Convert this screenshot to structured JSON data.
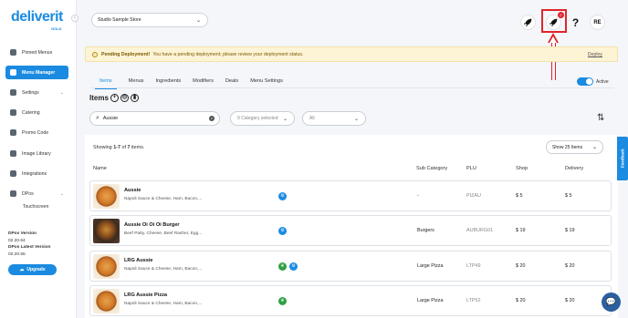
{
  "app": {
    "logo": "deliverit",
    "logo_sub": "GOLD"
  },
  "sidebar": {
    "items": [
      {
        "label": "Pinned Menus",
        "icon": "pin-icon"
      },
      {
        "label": "Menu Manager",
        "icon": "menu-manager-icon",
        "active": true
      },
      {
        "label": "Settings",
        "icon": "settings-icon",
        "expandable": true
      },
      {
        "label": "Catering",
        "icon": "catering-icon"
      },
      {
        "label": "Promo Code",
        "icon": "promo-icon"
      },
      {
        "label": "Image Library",
        "icon": "image-icon"
      },
      {
        "label": "Integrations",
        "icon": "integrations-icon"
      },
      {
        "label": "DPos",
        "icon": "dpos-icon",
        "expandable": true
      }
    ],
    "sub_item": "Touchscreen",
    "version_label": "DPos Version",
    "version_value": "02.20.64",
    "latest_label": "DPos Latest Version",
    "latest_value": "02.20.65",
    "upgrade_label": "Upgrade"
  },
  "topbar": {
    "store": "Studio Sample Store",
    "notification_count": "2",
    "help": "?",
    "avatar": "RE"
  },
  "banner": {
    "title": "Pending Deployment!",
    "message": "You have a pending deployment; please review your deployment status.",
    "action": "Deploy"
  },
  "tabs": [
    "Items",
    "Menus",
    "Ingredients",
    "Modifiers",
    "Deals",
    "Menu Settings"
  ],
  "active_toggle_label": "Active",
  "section_title": "Items",
  "search": {
    "value": "Aussie"
  },
  "filters": {
    "category": "0 Category selected",
    "status": "All"
  },
  "showing": {
    "prefix": "Showing ",
    "range": "1-7",
    "of": " of ",
    "total": "7",
    "suffix": " items."
  },
  "page_size": "Show 25 Items",
  "columns": {
    "name": "Name",
    "sub_category": "Sub Category",
    "plu": "PLU",
    "shop": "Shop",
    "delivery": "Delivery"
  },
  "rows": [
    {
      "name": "Aussie",
      "desc": "Napoli Sauce & Cheese, Ham, Bacon,...",
      "sub_category": "-",
      "plu": "PIZAU",
      "shop": "$ 5",
      "delivery": "$ 5"
    },
    {
      "name": "Aussie Oi Oi Oi Burger",
      "desc": "Beef Patty, Cheese, Beef Rasher, Egg...",
      "sub_category": "Burgers",
      "plu": "AUBURG01",
      "shop": "$ 19",
      "delivery": "$ 19"
    },
    {
      "name": "LRG Aussie",
      "desc": "Napoli Sauce & Cheese, Ham, Bacon,...",
      "sub_category": "Large Pizza",
      "plu": "LTP49",
      "shop": "$ 20",
      "delivery": "$ 20"
    },
    {
      "name": "LRG Aussie Pizza",
      "desc": "Napoli Sauce & Cheese, Ham, Bacon,...",
      "sub_category": "Large Pizza",
      "plu": "LTP52",
      "shop": "$ 20",
      "delivery": "$ 20"
    }
  ],
  "feedback_label": "Feedback",
  "colors": {
    "accent": "#1a8be0",
    "highlight": "#e0242b",
    "banner_bg": "#fdf4d6"
  }
}
